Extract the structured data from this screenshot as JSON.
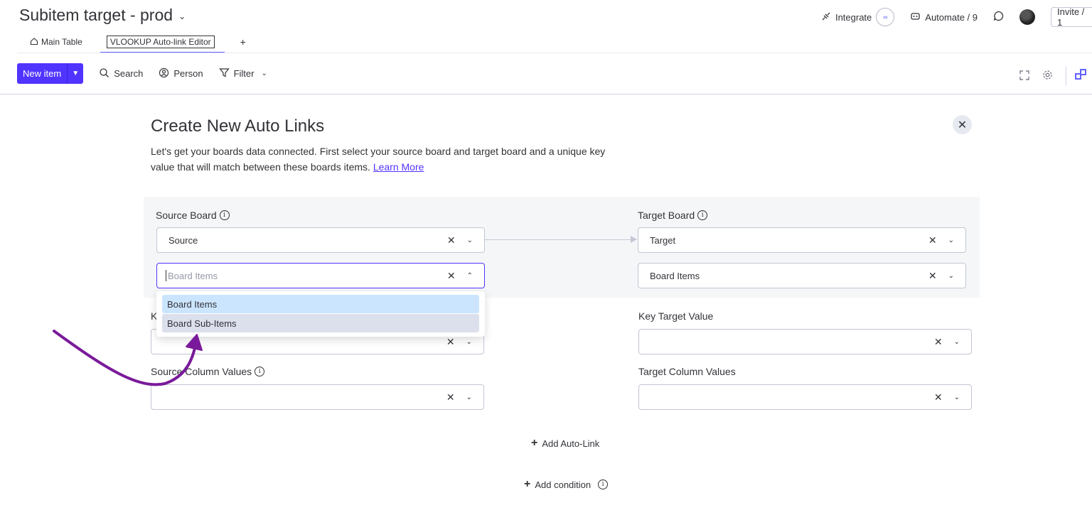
{
  "header": {
    "board_title": "Subitem target - prod",
    "integrate_label": "Integrate",
    "integrate_badge": "∞",
    "automate_label": "Automate / 9",
    "invite_label": "Invite / 1"
  },
  "tabs": [
    {
      "label": "Main Table",
      "icon": "home-icon"
    },
    {
      "label": "VLOOKUP Auto-link Editor",
      "active": true
    }
  ],
  "add_tab_label": "+",
  "toolbar": {
    "new_item_label": "New item",
    "search_label": "Search",
    "person_label": "Person",
    "filter_label": "Filter"
  },
  "panel": {
    "title": "Create New Auto Links",
    "description": "Let's get your boards data connected. First select your source board and target board and a unique key value that will match between these boards items.",
    "learn_more": "Learn More",
    "source_board_label": "Source Board",
    "target_board_label": "Target Board",
    "source_board_value": "Source",
    "target_board_value": "Target",
    "source_items_placeholder": "Board Items",
    "target_items_value": "Board Items",
    "key_source_label": "K",
    "key_target_label": "Key Target Value",
    "source_columns_label": "Source Column Values",
    "target_columns_label": "Target Column Values",
    "add_autolink": "Add Auto-Link",
    "add_condition": "Add condition"
  },
  "dropdown": {
    "options": [
      "Board Items",
      "Board Sub-Items"
    ]
  },
  "colors": {
    "accent": "#5034ff",
    "annotation_arrow": "#7a1a9a"
  }
}
